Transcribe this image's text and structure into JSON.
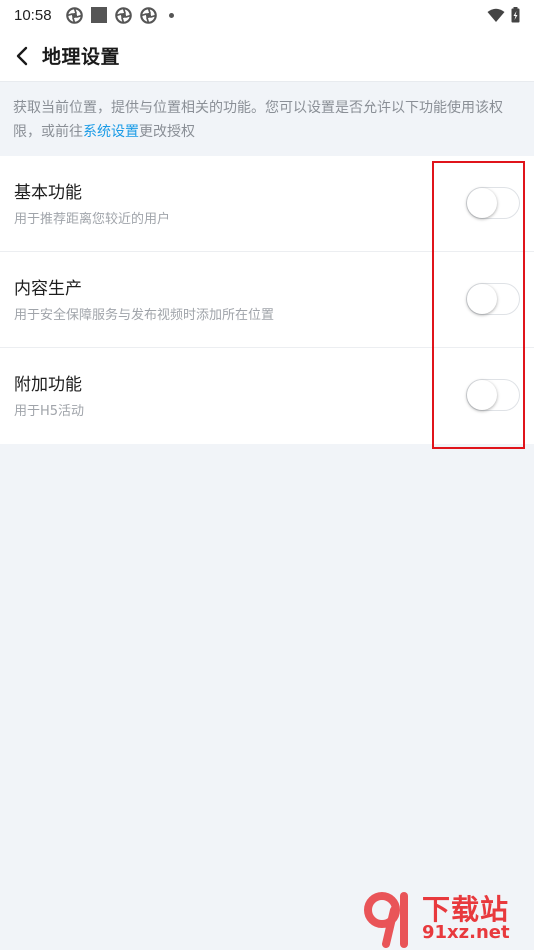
{
  "status_bar": {
    "time": "10:58",
    "left_icons": [
      "aperture-icon",
      "square-icon",
      "aperture-icon",
      "aperture-icon",
      "dot-icon"
    ],
    "right_icons": [
      "wifi-icon",
      "battery-icon"
    ]
  },
  "header": {
    "title": "地理设置",
    "back_icon": "chevron-left-icon"
  },
  "description": {
    "text_before": "获取当前位置，提供与位置相关的功能。您可以设置是否允许以下功能使用该权限，或前往",
    "link": "系统设置",
    "text_after": "更改授权"
  },
  "settings": [
    {
      "title": "基本功能",
      "subtitle": "用于推荐距离您较近的用户",
      "enabled": false
    },
    {
      "title": "内容生产",
      "subtitle": "用于安全保障服务与发布视频时添加所在位置",
      "enabled": false
    },
    {
      "title": "附加功能",
      "subtitle": "用于H5活动",
      "enabled": false
    }
  ],
  "colors": {
    "accent_link": "#1a9be6",
    "highlight_border": "#e0141b",
    "background": "#f1f4f8",
    "watermark": "#e8393d"
  },
  "watermark": {
    "line1": "下载站",
    "line2": "91xz.net"
  }
}
